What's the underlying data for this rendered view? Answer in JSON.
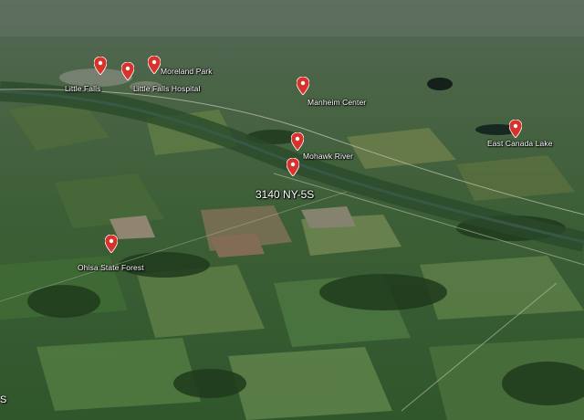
{
  "colors": {
    "pin": "#d8322c",
    "label": "#ffffff"
  },
  "address": "3140 NY-5S",
  "places": [
    {
      "name": "Little Falls"
    },
    {
      "name": "Little Falls Hospital"
    },
    {
      "name": "Moreland Park"
    },
    {
      "name": "Manheim Center"
    },
    {
      "name": "Mohawk River"
    },
    {
      "name": "East Canada Lake"
    },
    {
      "name": "Ohisa State Forest"
    }
  ],
  "edge_text": "S"
}
